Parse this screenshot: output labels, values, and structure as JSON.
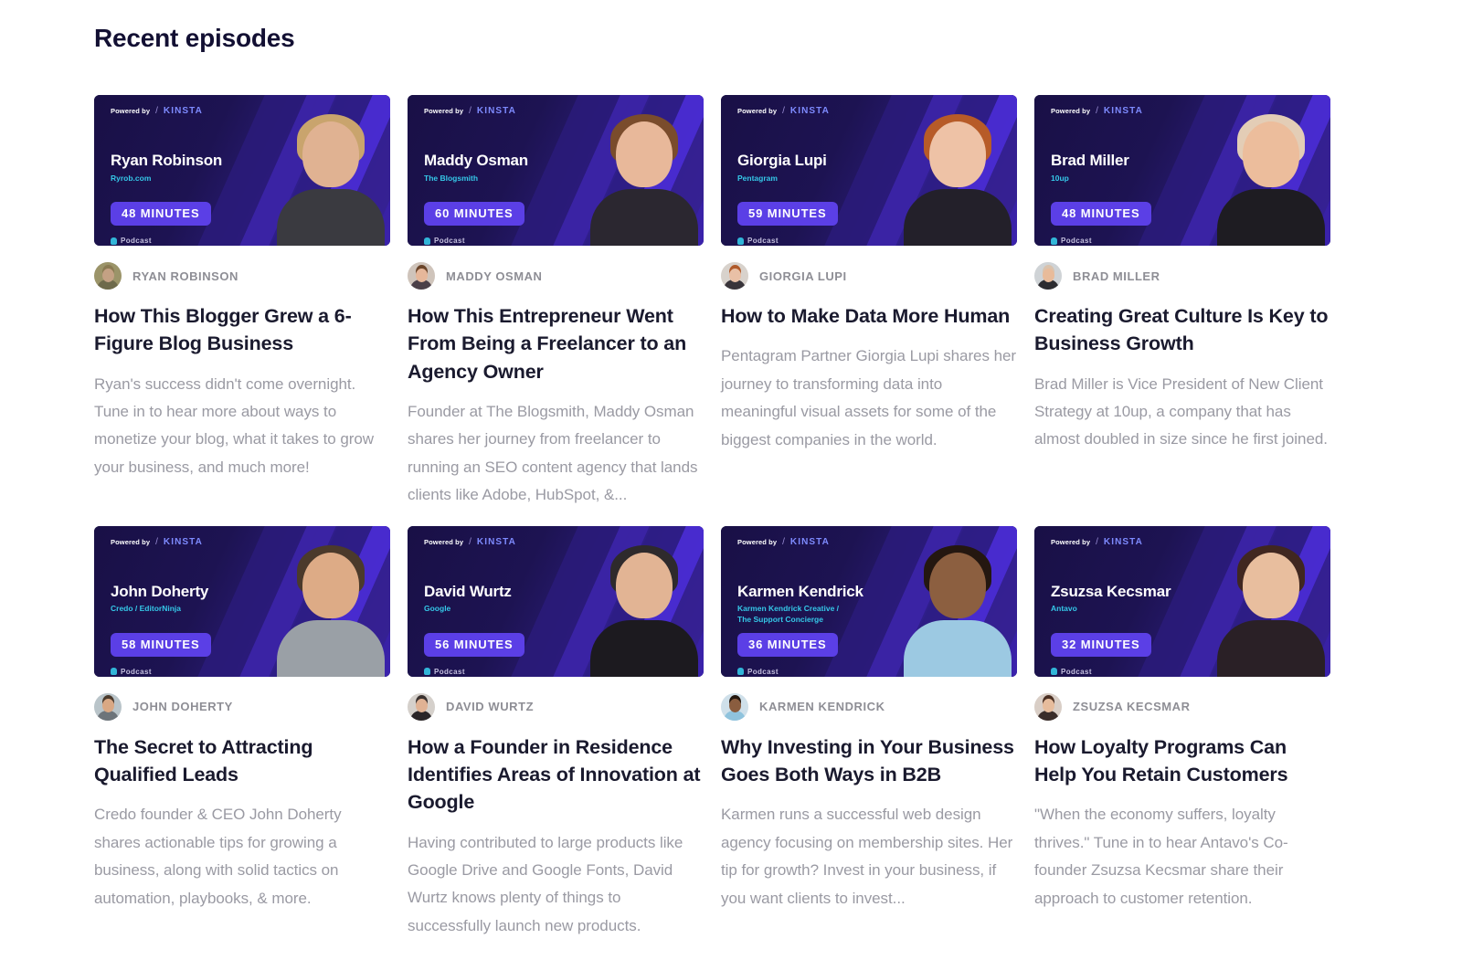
{
  "section": {
    "heading": "Recent episodes"
  },
  "thumbnail_common": {
    "powered_text": "Powered by",
    "powered_slash": "/",
    "powered_brand": "KINSTA",
    "podcast_label": "Podcast"
  },
  "colors": {
    "badge_purple": "#5b3fe6",
    "company_cyan": "#35c8e8",
    "heading_navy": "#131033",
    "title_dark": "#1a1a2e",
    "desc_gray": "#9a9aa3",
    "author_gray": "#8e8e95",
    "brand_blue": "#7e8bff"
  },
  "episodes": [
    {
      "guest_name": "Ryan Robinson",
      "guest_company": "Ryrob.com",
      "duration": "48 MINUTES",
      "author": "RYAN ROBINSON",
      "title": "How This Blogger Grew a 6-Figure Blog Business",
      "description": "Ryan's success didn't come overnight. Tune in to hear more about ways to monetize your blog, what it takes to grow your business, and much more!",
      "avatar_skin": "#c4a184",
      "avatar_hair": "#8a7a52",
      "avatar_bg": "#9b9469",
      "avatar_body": "#6e6a4b",
      "portrait_skin": "#e0b292",
      "portrait_hair": "#c9a46d",
      "portrait_body": "#3a3a40"
    },
    {
      "guest_name": "Maddy Osman",
      "guest_company": "The Blogsmith",
      "duration": "60 MINUTES",
      "author": "MADDY OSMAN",
      "title": "How This Entrepreneur Went From Being a Freelancer to an Agency Owner",
      "description": "Founder at The Blogsmith, Maddy Osman shares her journey from freelancer to running an SEO content agency that lands clients like Adobe, HubSpot, &...",
      "avatar_skin": "#e6b79a",
      "avatar_hair": "#6b452a",
      "avatar_bg": "#cfc4bb",
      "avatar_body": "#4b4048",
      "portrait_skin": "#e8b89a",
      "portrait_hair": "#7a4c2c",
      "portrait_body": "#2b2730"
    },
    {
      "guest_name": "Giorgia Lupi",
      "guest_company": "Pentagram",
      "duration": "59 MINUTES",
      "author": "GIORGIA LUPI",
      "title": "How to Make Data More Human",
      "description": "Pentagram Partner Giorgia Lupi shares her journey to transforming data into meaningful visual assets for some of the biggest companies in the world.",
      "avatar_skin": "#e9c0a6",
      "avatar_hair": "#b05a2a",
      "avatar_bg": "#d8d2cc",
      "avatar_body": "#39343a",
      "portrait_skin": "#eec2a6",
      "portrait_hair": "#b75b28",
      "portrait_body": "#23202a"
    },
    {
      "guest_name": "Brad Miller",
      "guest_company": "10up",
      "duration": "48 MINUTES",
      "author": "BRAD MILLER",
      "title": "Creating Great Culture Is Key to Business Growth",
      "description": "Brad Miller is Vice President of New Client Strategy at 10up, a company that has almost doubled in size since he first joined.",
      "avatar_skin": "#e8bb9a",
      "avatar_hair": "#d9c2ad",
      "avatar_bg": "#cfd3d6",
      "avatar_body": "#2c2c30",
      "portrait_skin": "#ecbd9c",
      "portrait_hair": "#e3cdb6",
      "portrait_body": "#1e1c22"
    },
    {
      "guest_name": "John Doherty",
      "guest_company": "Credo / EditorNinja",
      "duration": "58 MINUTES",
      "author": "JOHN DOHERTY",
      "title": "The Secret to Attracting Qualified Leads",
      "description": "Credo founder & CEO John Doherty shares actionable tips for growing a business, along with solid tactics on automation, playbooks, & more.",
      "avatar_skin": "#d9a884",
      "avatar_hair": "#4a3a2c",
      "avatar_bg": "#b9c4c9",
      "avatar_body": "#6d747a",
      "portrait_skin": "#ddab86",
      "portrait_hair": "#4b3a2b",
      "portrait_body": "#9aa0a6"
    },
    {
      "guest_name": "David Wurtz",
      "guest_company": "Google",
      "duration": "56 MINUTES",
      "author": "DAVID WURTZ",
      "title": "How a Founder in Residence Identifies Areas of Innovation at Google",
      "description": "Having contributed to large products like Google Drive and Google Fonts, David Wurtz knows plenty of things to successfully launch new products.",
      "avatar_skin": "#e0b294",
      "avatar_hair": "#3b3230",
      "avatar_bg": "#d5d0cb",
      "avatar_body": "#2a2528",
      "portrait_skin": "#e2b494",
      "portrait_hair": "#2e2a2c",
      "portrait_body": "#1c1a1f"
    },
    {
      "guest_name": "Karmen Kendrick",
      "guest_company": "Karmen Kendrick Creative /\nThe Support Concierge",
      "duration": "36 MINUTES",
      "author": "KARMEN KENDRICK",
      "title": "Why Investing in Your Business Goes Both Ways in B2B",
      "description": "Karmen runs a successful web design agency focusing on membership sites. Her tip for growth? Invest in your business, if you want clients to invest...",
      "avatar_skin": "#8a5d3f",
      "avatar_hair": "#24170f",
      "avatar_bg": "#cfe0ea",
      "avatar_body": "#8fc3dd",
      "portrait_skin": "#8c5f40",
      "portrait_hair": "#241710",
      "portrait_body": "#9cc9e2"
    },
    {
      "guest_name": "Zsuzsa Kecsmar",
      "guest_company": "Antavo",
      "duration": "32 MINUTES",
      "author": "ZSUZSA KECSMAR",
      "title": "How Loyalty Programs Can Help You Retain Customers",
      "description": "\"When the economy suffers, loyalty thrives.\" Tune in to hear Antavo's Co-founder Zsuzsa Kecsmar share their approach to customer retention.",
      "avatar_skin": "#e6bc9c",
      "avatar_hair": "#4a2f22",
      "avatar_bg": "#d9cec6",
      "avatar_body": "#3a2d2a",
      "portrait_skin": "#e8be9e",
      "portrait_hair": "#402720",
      "portrait_body": "#2a2026"
    }
  ]
}
